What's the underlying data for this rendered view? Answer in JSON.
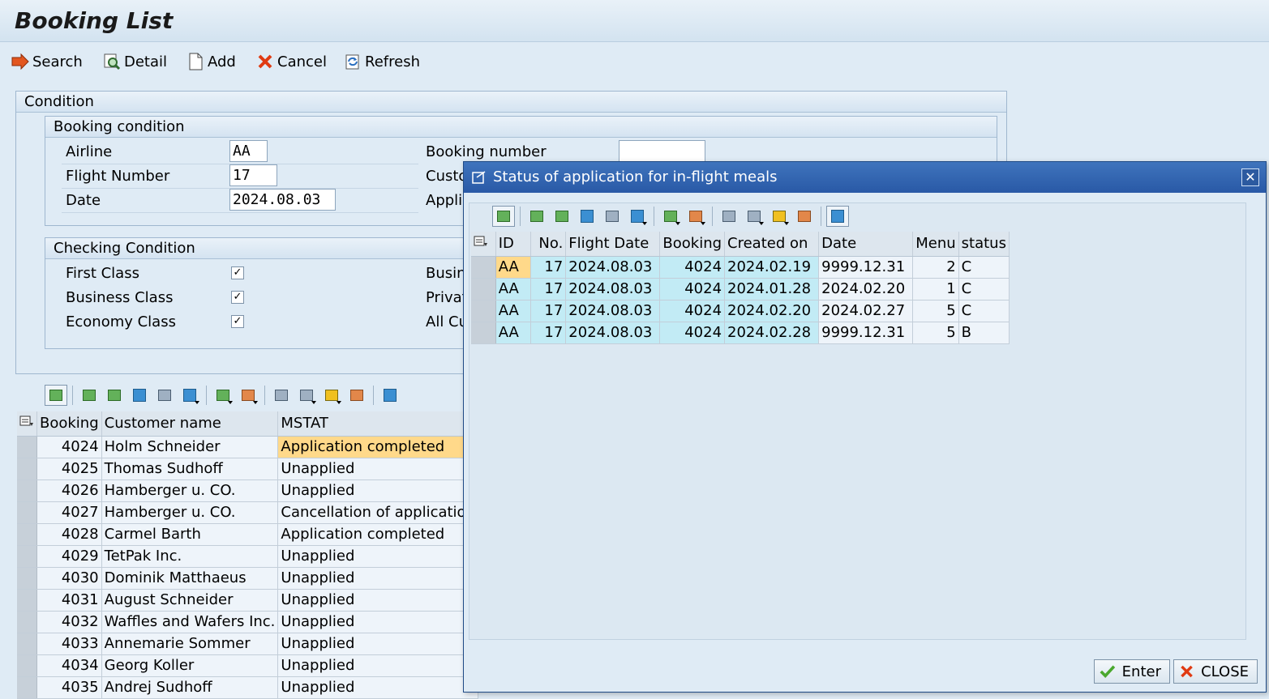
{
  "title": "Booking List",
  "toolbar": {
    "search": "Search",
    "detail": "Detail",
    "add": "Add",
    "cancel": "Cancel",
    "refresh": "Refresh"
  },
  "condition": {
    "title": "Condition",
    "booking": {
      "title": "Booking condition",
      "airline_label": "Airline",
      "airline_value": "AA",
      "flight_label": "Flight Number",
      "flight_value": "17",
      "date_label": "Date",
      "date_value": "2024.08.03",
      "booking_number_label": "Booking number",
      "booking_number_value": "",
      "customer_label_partial": "Custo",
      "application_label_partial": "Applic"
    },
    "checking": {
      "title": "Checking Condition",
      "first_label": "First Class",
      "business_label": "Business Class",
      "economy_label": "Economy Class",
      "first_checked": true,
      "business_checked": true,
      "economy_checked": true,
      "right1_partial": "Busin",
      "right2_partial": "Privat",
      "right3_partial": "All Cu",
      "check_glyph": "✓"
    }
  },
  "main_grid": {
    "headers": [
      "Booking",
      "Customer name",
      "MSTAT"
    ],
    "rows": [
      {
        "booking": "4024",
        "customer": "Holm Schneider",
        "mstat": "Application completed"
      },
      {
        "booking": "4025",
        "customer": "Thomas Sudhoff",
        "mstat": "Unapplied"
      },
      {
        "booking": "4026",
        "customer": "Hamberger u. CO.",
        "mstat": "Unapplied"
      },
      {
        "booking": "4027",
        "customer": "Hamberger u. CO.",
        "mstat": "Cancellation of application"
      },
      {
        "booking": "4028",
        "customer": "Carmel Barth",
        "mstat": "Application completed"
      },
      {
        "booking": "4029",
        "customer": "TetPak Inc.",
        "mstat": "Unapplied"
      },
      {
        "booking": "4030",
        "customer": "Dominik Matthaeus",
        "mstat": "Unapplied"
      },
      {
        "booking": "4031",
        "customer": "August Schneider",
        "mstat": "Unapplied"
      },
      {
        "booking": "4032",
        "customer": "Waffles and Wafers Inc.",
        "mstat": "Unapplied"
      },
      {
        "booking": "4033",
        "customer": "Annemarie Sommer",
        "mstat": "Unapplied"
      },
      {
        "booking": "4034",
        "customer": "Georg Koller",
        "mstat": "Unapplied"
      },
      {
        "booking": "4035",
        "customer": "Andrej Sudhoff",
        "mstat": "Unapplied"
      }
    ]
  },
  "dialog": {
    "title": "Status of application for in-flight meals",
    "close_glyph": "✕",
    "headers": [
      "ID",
      "No.",
      "Flight Date",
      "Booking",
      "Created on",
      "Date",
      "Menu",
      "status"
    ],
    "rows": [
      {
        "id": "AA",
        "no": "17",
        "flight_date": "2024.08.03",
        "booking": "4024",
        "created_on": "2024.02.19",
        "date": "9999.12.31",
        "menu": "2",
        "status": "C"
      },
      {
        "id": "AA",
        "no": "17",
        "flight_date": "2024.08.03",
        "booking": "4024",
        "created_on": "2024.01.28",
        "date": "2024.02.20",
        "menu": "1",
        "status": "C"
      },
      {
        "id": "AA",
        "no": "17",
        "flight_date": "2024.08.03",
        "booking": "4024",
        "created_on": "2024.02.20",
        "date": "2024.02.27",
        "menu": "5",
        "status": "C"
      },
      {
        "id": "AA",
        "no": "17",
        "flight_date": "2024.08.03",
        "booking": "4024",
        "created_on": "2024.02.28",
        "date": "9999.12.31",
        "menu": "5",
        "status": "B"
      }
    ],
    "enter": "Enter",
    "close": "CLOSE"
  },
  "colors": {
    "dialog_title": "#2959a6",
    "highlight": "#ffd98a",
    "key_column": "#c2ebf5"
  }
}
